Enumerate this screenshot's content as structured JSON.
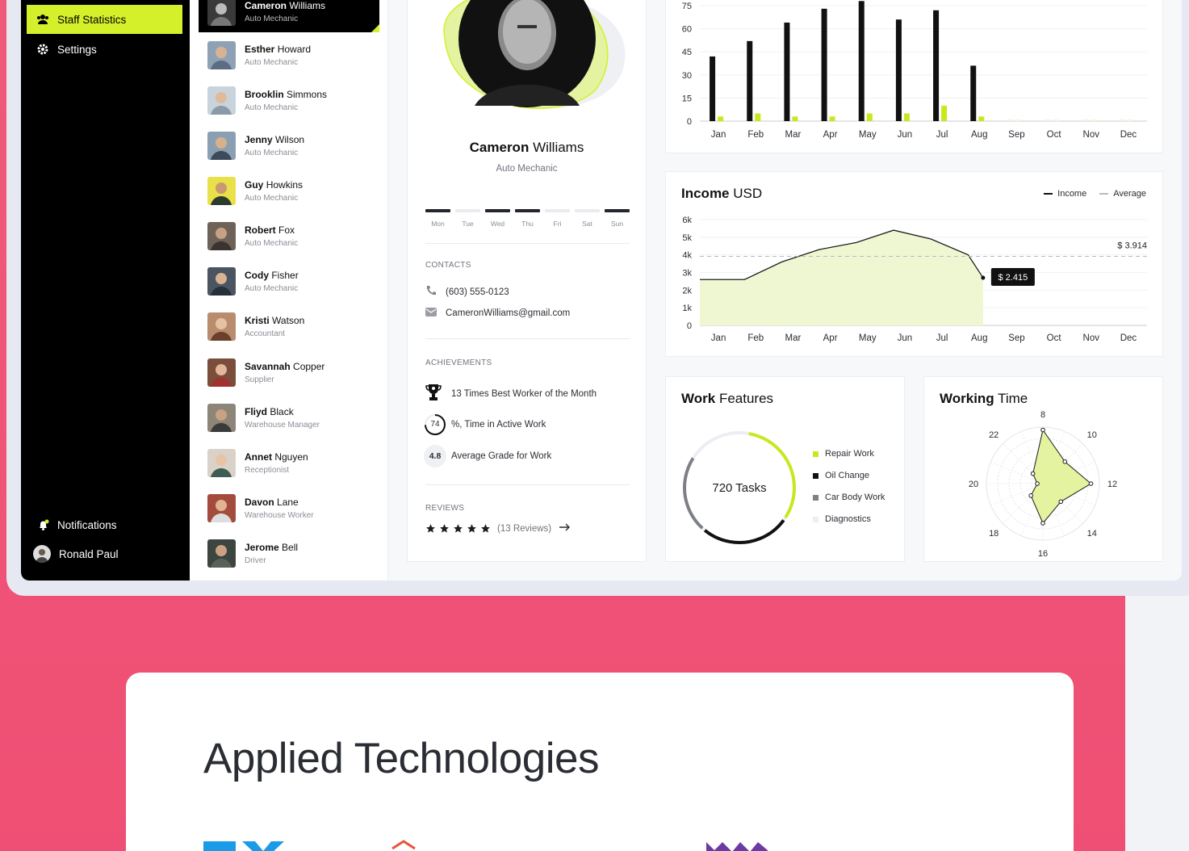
{
  "colors": {
    "accent": "#d4f02b",
    "sidebar": "#000000",
    "pink": "#ef4f74"
  },
  "sidebar": {
    "items": [
      {
        "label": "Staff Statistics",
        "icon": "users-icon",
        "active": true
      },
      {
        "label": "Settings",
        "icon": "gear-icon",
        "active": false
      }
    ],
    "notifications": "Notifications",
    "user": "Ronald Paul"
  },
  "staff": [
    {
      "first": "Cameron",
      "last": "Williams",
      "role": "Auto Mechanic"
    },
    {
      "first": "Esther",
      "last": "Howard",
      "role": "Auto Mechanic"
    },
    {
      "first": "Brooklin",
      "last": "Simmons",
      "role": "Auto Mechanic"
    },
    {
      "first": "Jenny",
      "last": "Wilson",
      "role": "Auto Mechanic"
    },
    {
      "first": "Guy",
      "last": "Howkins",
      "role": "Auto Mechanic"
    },
    {
      "first": "Robert",
      "last": "Fox",
      "role": "Auto Mechanic"
    },
    {
      "first": "Cody",
      "last": "Fisher",
      "role": "Auto Mechanic"
    },
    {
      "first": "Kristi",
      "last": "Watson",
      "role": "Accountant"
    },
    {
      "first": "Savannah",
      "last": "Copper",
      "role": "Supplier"
    },
    {
      "first": "Fliyd",
      "last": "Black",
      "role": "Warehouse Manager"
    },
    {
      "first": "Annet",
      "last": "Nguyen",
      "role": "Receptionist"
    },
    {
      "first": "Davon",
      "last": "Lane",
      "role": "Warehouse Worker"
    },
    {
      "first": "Jerome",
      "last": "Bell",
      "role": "Driver"
    }
  ],
  "profile": {
    "first": "Cameron",
    "last": "Williams",
    "role": "Auto Mechanic",
    "days": [
      "Mon",
      "Tue",
      "Wed",
      "Thu",
      "Fri",
      "Sat",
      "Sun"
    ],
    "days_worked": [
      true,
      false,
      true,
      true,
      false,
      false,
      true
    ],
    "contacts_label": "CONTACTS",
    "phone": "(603) 555-0123",
    "email": "CameronWilliams@gmail.com",
    "achievements_label": "ACHIEVEMENTS",
    "achievement_1": "13 Times Best Worker of the Month",
    "achievement_2_value": "74",
    "achievement_2": "%, Time in Active Work",
    "achievement_3_value": "4.8",
    "achievement_3": "Average Grade for Work",
    "reviews_label": "REVIEWS",
    "stars": 5,
    "reviews_count": "(13 Reviews)"
  },
  "work_features": {
    "title_bold": "Work",
    "title_rest": "Features",
    "center": "720 Tasks",
    "items": [
      {
        "label": "Repair Work",
        "color": "#c8e81e"
      },
      {
        "label": "Oil Change",
        "color": "#111111"
      },
      {
        "label": "Car Body Work",
        "color": "#7e8088"
      },
      {
        "label": "Diagnostics",
        "color": "#eceef2"
      }
    ]
  },
  "working_time": {
    "title_bold": "Working",
    "title_rest": "Time"
  },
  "income_card": {
    "title_bold": "Income",
    "title_rest": "USD",
    "legend_income": "Income",
    "legend_average": "Average"
  },
  "tech": {
    "title": "Applied Technologies"
  },
  "chart_data": [
    {
      "type": "bar",
      "categories": [
        "Jan",
        "Feb",
        "Mar",
        "Apr",
        "May",
        "Jun",
        "Jul",
        "Aug",
        "Sep",
        "Oct",
        "Nov",
        "Dec"
      ],
      "series": [
        {
          "values": [
            42,
            52,
            64,
            73,
            78,
            66,
            72,
            36,
            0,
            0,
            0,
            0
          ]
        },
        {
          "values": [
            3,
            5,
            3,
            3,
            5,
            5,
            10,
            3,
            0,
            0,
            0,
            0
          ]
        }
      ],
      "ylim": [
        0,
        75
      ],
      "yticks": [
        0,
        15,
        30,
        45,
        60,
        75
      ]
    },
    {
      "type": "area",
      "categories": [
        "Jan",
        "Feb",
        "Mar",
        "Apr",
        "May",
        "Jun",
        "Jul",
        "Aug",
        "Sep",
        "Oct",
        "Nov",
        "Dec"
      ],
      "series": [
        {
          "name": "Income",
          "values": [
            2.6,
            2.6,
            3.6,
            4.3,
            4.7,
            5.4,
            4.9,
            4.0,
            2.7
          ]
        }
      ],
      "average": 3.914,
      "average_label": "$ 3.914",
      "current_label": "$ 2.415",
      "ylim": [
        0,
        6
      ],
      "yticks": [
        "0",
        "1k",
        "2k",
        "3k",
        "4k",
        "5k",
        "6k"
      ]
    },
    {
      "type": "radar",
      "axes": [
        "8",
        "10",
        "12",
        "14",
        "16",
        "18",
        "20",
        "22"
      ],
      "values": [
        0.95,
        0.55,
        0.85,
        0.45,
        0.7,
        0.3,
        0.1,
        0.25
      ],
      "rmax": 1
    }
  ]
}
